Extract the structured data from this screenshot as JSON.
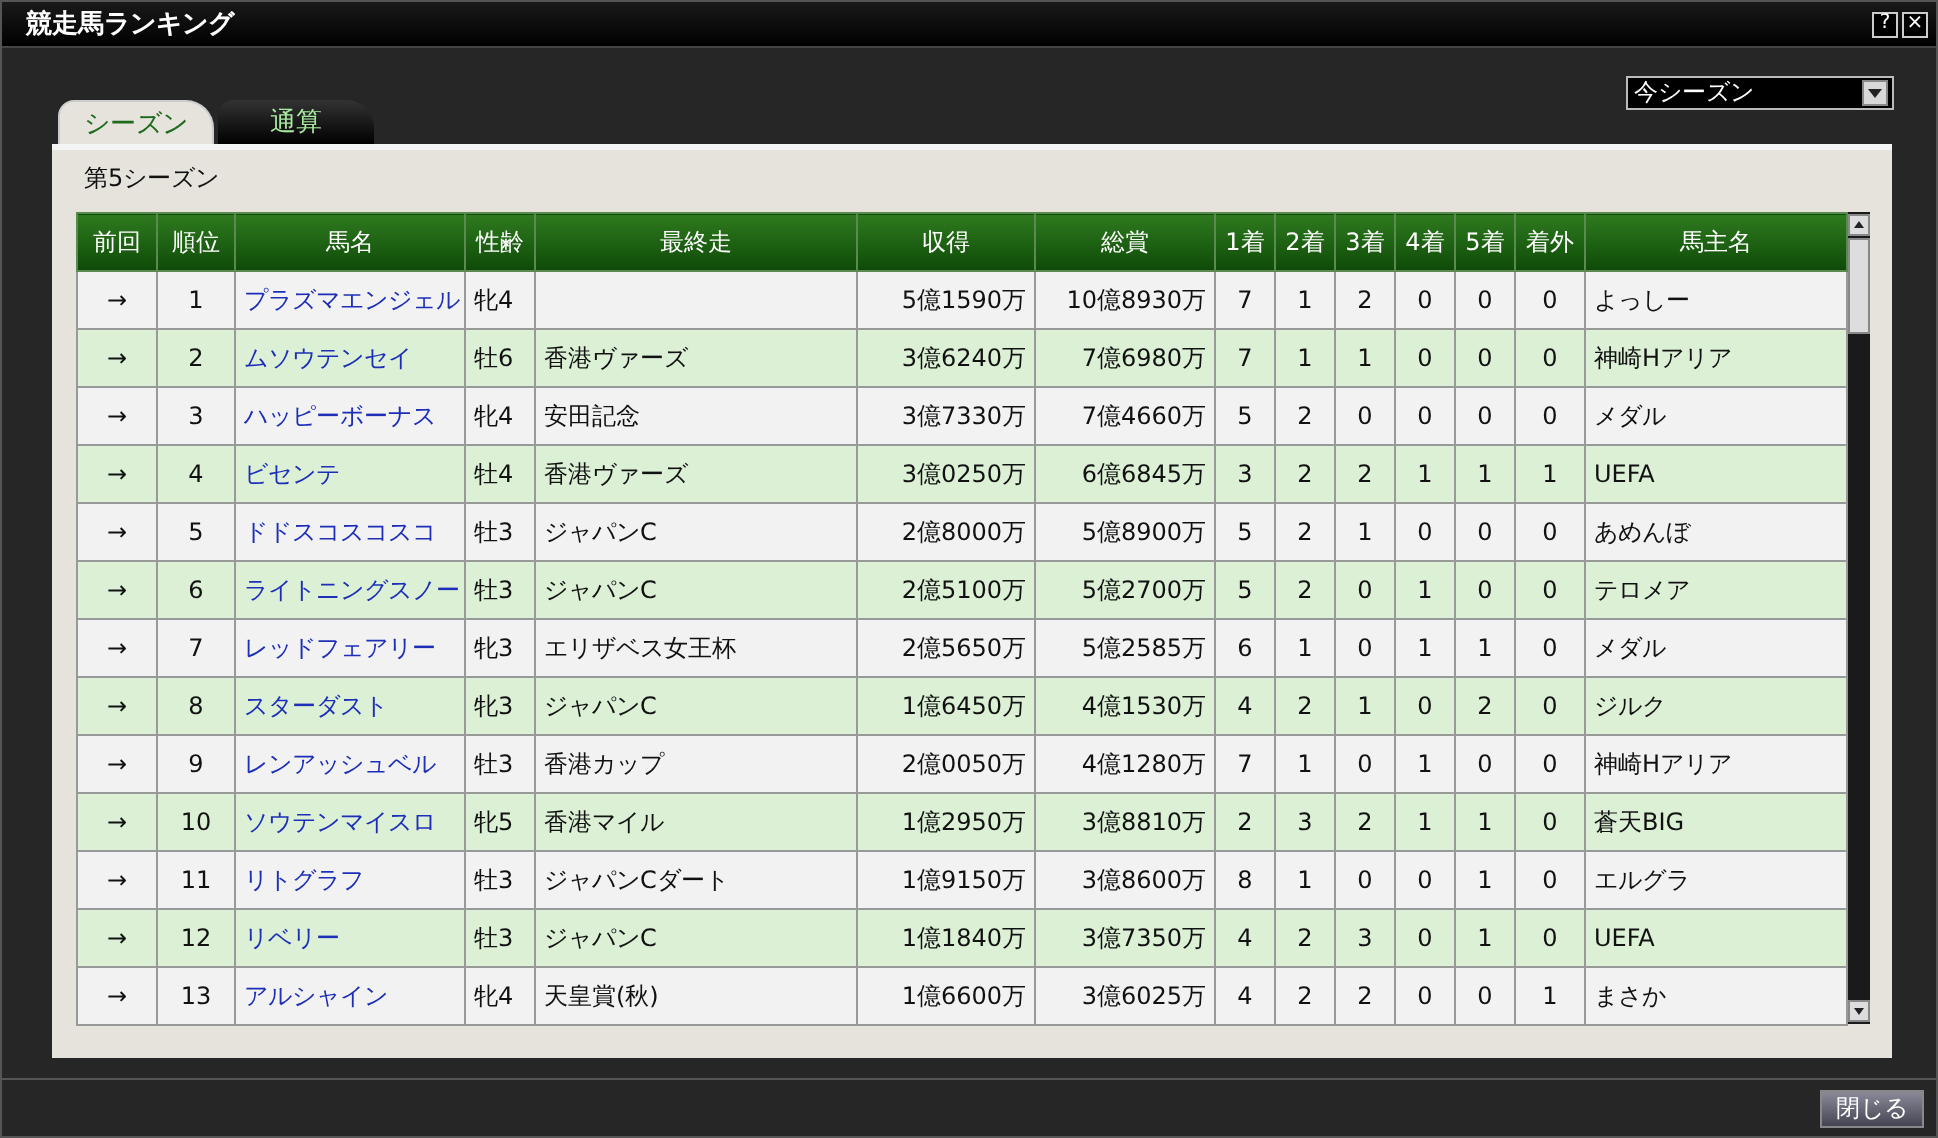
{
  "window": {
    "title": "競走馬ランキング",
    "buttons": [
      "?",
      "×"
    ]
  },
  "tabs": [
    {
      "label": "シーズン",
      "selected": true
    },
    {
      "label": "通算",
      "selected": false
    }
  ],
  "period_dropdown": {
    "value": "今シーズン"
  },
  "caption": "第5シーズン",
  "table": {
    "columns": [
      {
        "label": "前回",
        "kind": "center"
      },
      {
        "label": "順位",
        "kind": "center"
      },
      {
        "label": "馬名",
        "kind": "link"
      },
      {
        "label": "性齢",
        "kind": "left"
      },
      {
        "label": "最終走",
        "kind": "left"
      },
      {
        "label": "収得",
        "kind": "right"
      },
      {
        "label": "総賞",
        "kind": "right"
      },
      {
        "label": "1着",
        "kind": "center"
      },
      {
        "label": "2着",
        "kind": "center"
      },
      {
        "label": "3着",
        "kind": "center"
      },
      {
        "label": "4着",
        "kind": "center"
      },
      {
        "label": "5着",
        "kind": "center"
      },
      {
        "label": "着外",
        "kind": "center"
      },
      {
        "label": "馬主名",
        "kind": "left"
      }
    ],
    "rows": [
      [
        "→",
        "1",
        "プラズマエンジェル",
        "牝4",
        "",
        "5億1590万",
        "10億8930万",
        "7",
        "1",
        "2",
        "0",
        "0",
        "0",
        "よっしー"
      ],
      [
        "→",
        "2",
        "ムソウテンセイ",
        "牡6",
        "香港ヴァーズ",
        "3億6240万",
        "7億6980万",
        "7",
        "1",
        "1",
        "0",
        "0",
        "0",
        "神崎Hアリア"
      ],
      [
        "→",
        "3",
        "ハッピーボーナス",
        "牝4",
        "安田記念",
        "3億7330万",
        "7億4660万",
        "5",
        "2",
        "0",
        "0",
        "0",
        "0",
        "メダル"
      ],
      [
        "→",
        "4",
        "ビセンテ",
        "牡4",
        "香港ヴァーズ",
        "3億0250万",
        "6億6845万",
        "3",
        "2",
        "2",
        "1",
        "1",
        "1",
        "UEFA"
      ],
      [
        "→",
        "5",
        "ドドスコスコスコ",
        "牡3",
        "ジャパンC",
        "2億8000万",
        "5億8900万",
        "5",
        "2",
        "1",
        "0",
        "0",
        "0",
        "あめんぼ"
      ],
      [
        "→",
        "6",
        "ライトニングスノー",
        "牡3",
        "ジャパンC",
        "2億5100万",
        "5億2700万",
        "5",
        "2",
        "0",
        "1",
        "0",
        "0",
        "テロメア"
      ],
      [
        "→",
        "7",
        "レッドフェアリー",
        "牝3",
        "エリザベス女王杯",
        "2億5650万",
        "5億2585万",
        "6",
        "1",
        "0",
        "1",
        "1",
        "0",
        "メダル"
      ],
      [
        "→",
        "8",
        "スターダスト",
        "牝3",
        "ジャパンC",
        "1億6450万",
        "4億1530万",
        "4",
        "2",
        "1",
        "0",
        "2",
        "0",
        "ジルク"
      ],
      [
        "→",
        "9",
        "レンアッシュベル",
        "牡3",
        "香港カップ",
        "2億0050万",
        "4億1280万",
        "7",
        "1",
        "0",
        "1",
        "0",
        "0",
        "神崎Hアリア"
      ],
      [
        "→",
        "10",
        "ソウテンマイスロ",
        "牝5",
        "香港マイル",
        "1億2950万",
        "3億8810万",
        "2",
        "3",
        "2",
        "1",
        "1",
        "0",
        "蒼天BIG"
      ],
      [
        "→",
        "11",
        "リトグラフ",
        "牡3",
        "ジャパンCダート",
        "1億9150万",
        "3億8600万",
        "8",
        "1",
        "0",
        "0",
        "1",
        "0",
        "エルグラ"
      ],
      [
        "→",
        "12",
        "リベリー",
        "牡3",
        "ジャパンC",
        "1億1840万",
        "3億7350万",
        "4",
        "2",
        "3",
        "0",
        "1",
        "0",
        "UEFA"
      ],
      [
        "→",
        "13",
        "アルシャイン",
        "牝4",
        "天皇賞(秋)",
        "1億6600万",
        "3億6025万",
        "4",
        "2",
        "2",
        "0",
        "0",
        "1",
        "まさか"
      ]
    ]
  },
  "close_button": "閉じる"
}
